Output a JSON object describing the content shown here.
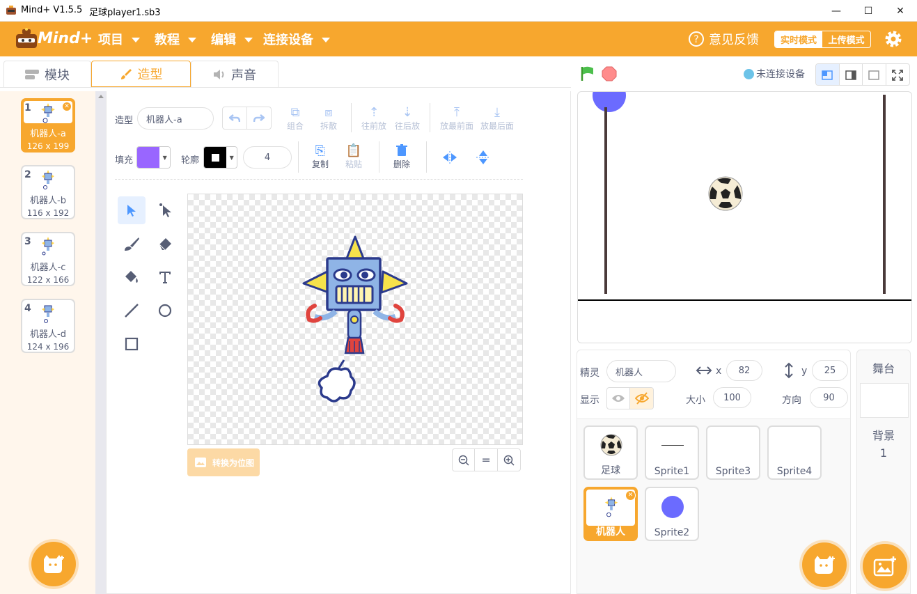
{
  "titlebar": {
    "app": "Mind+ V1.5.5",
    "file": "足球player1.sb3",
    "min": "—",
    "max": "☐",
    "close": "✕"
  },
  "menubar": {
    "logo": "Mind+",
    "items": [
      "项目",
      "教程",
      "编辑",
      "连接设备"
    ],
    "feedback": "意见反馈",
    "realtime": "实时模式",
    "upload": "上传模式"
  },
  "tabs": {
    "blocks": "模块",
    "costumes": "造型",
    "sounds": "声音"
  },
  "costumes": [
    {
      "num": "1",
      "name": "机器人-a",
      "size": "126 x 199"
    },
    {
      "num": "2",
      "name": "机器人-b",
      "size": "116 x 192"
    },
    {
      "num": "3",
      "name": "机器人-c",
      "size": "122 x 166"
    },
    {
      "num": "4",
      "name": "机器人-d",
      "size": "124 x 196"
    }
  ],
  "editor": {
    "costume_label": "造型",
    "costume_name": "机器人-a",
    "group": "组合",
    "ungroup": "拆散",
    "forward": "往前放",
    "backward": "往后放",
    "front": "放最前面",
    "back": "放最后面",
    "fill_label": "填充",
    "outline_label": "轮廓",
    "outline_width": "4",
    "copy": "复制",
    "paste": "粘贴",
    "delete": "删除",
    "convert": "转换为位图",
    "zoom_reset": "="
  },
  "colors": {
    "accent": "#f7a72e",
    "fill": "#9966ff",
    "outline": "#000000"
  },
  "stage": {
    "connection": "未连接设备"
  },
  "sprite": {
    "label": "精灵",
    "name": "机器人",
    "x_label": "x",
    "x": "82",
    "y_label": "y",
    "y": "25",
    "show_label": "显示",
    "size_label": "大小",
    "size": "100",
    "dir_label": "方向",
    "dir": "90"
  },
  "sprites": [
    {
      "name": "足球",
      "icon": "soccer-ball"
    },
    {
      "name": "Sprite1",
      "icon": "line"
    },
    {
      "name": "Sprite3",
      "icon": "empty"
    },
    {
      "name": "Sprite4",
      "icon": "empty"
    },
    {
      "name": "机器人",
      "icon": "robot"
    },
    {
      "name": "Sprite2",
      "icon": "blue-circle"
    }
  ],
  "stagepanel": {
    "title": "舞台",
    "backdrop_label": "背景",
    "backdrop_count": "1"
  }
}
